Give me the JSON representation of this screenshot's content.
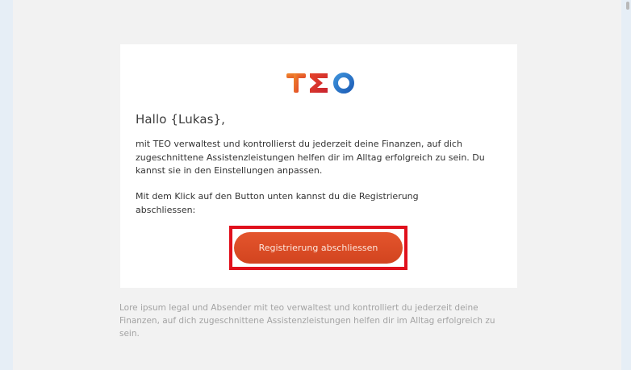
{
  "email": {
    "logo_text": "TEO",
    "logo_colors": [
      "#e4572e",
      "#d63a26",
      "#2a6fc9"
    ],
    "greeting": "Hallo {Lukas},",
    "paragraph1": "mit TEO verwaltest und kontrollierst du jederzeit deine Finanzen, auf dich zugeschnittene Assistenzleistungen helfen dir im Alltag erfolgreich zu sein. Du kannst sie in den Einstellungen anpassen.",
    "paragraph2": "Mit dem Klick auf den Button unten kannst du die Registrierung abschliessen:",
    "cta_label": "Registrierung abschliessen",
    "cta_color": "#d94a24",
    "highlight_color": "#e0101c"
  },
  "footer": {
    "text": "Lore ipsum legal und Absender mit teo verwaltest und kontrolliert du jederzeit deine Finanzen, auf dich zugeschnittene Assistenzleistungen helfen dir im Alltag erfolgreich zu sein."
  }
}
